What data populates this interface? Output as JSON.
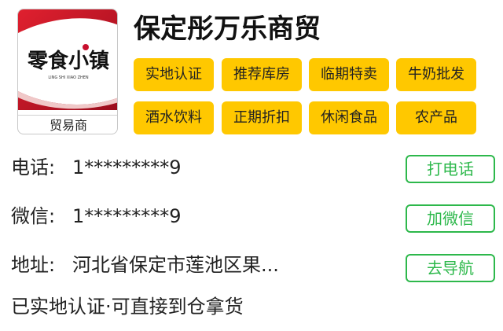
{
  "shop": {
    "name": "保定彤万乐商贸",
    "logo_text": "零食小镇",
    "logo_subtext": "LING SHI XIAO ZHEN",
    "badge": "贸易商"
  },
  "tags": [
    "实地认证",
    "推荐库房",
    "临期特卖",
    "牛奶批发",
    "酒水饮料",
    "正期折扣",
    "休闲食品",
    "农产品"
  ],
  "contact": {
    "phone_label": "电话:",
    "phone_value": "1*********9",
    "call_button": "打电话",
    "wechat_label": "微信:",
    "wechat_value": "1*********9",
    "wechat_button": "加微信",
    "address_label": "地址:",
    "address_value": "河北省保定市莲池区果...",
    "nav_button": "去导航"
  },
  "note": "已实地认证·可直接到仓拿货",
  "colors": {
    "tag_bg": "#ffc800",
    "button_green": "#2db84b",
    "logo_red": "#c8102e"
  }
}
